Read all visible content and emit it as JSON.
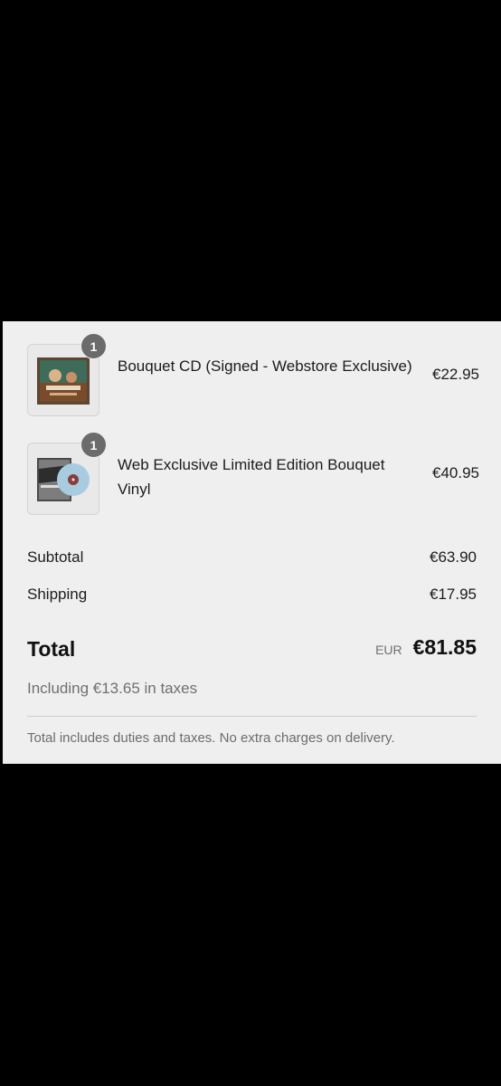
{
  "line_items": [
    {
      "name": "Bouquet CD (Signed - Webstore Exclusive)",
      "quantity": "1",
      "price": "€22.95",
      "thumbnail": "cd-cover-art"
    },
    {
      "name": "Web Exclusive Limited Edition Bouquet Vinyl",
      "quantity": "1",
      "price": "€40.95",
      "thumbnail": "vinyl-cover-art"
    }
  ],
  "summary": {
    "subtotal_label": "Subtotal",
    "subtotal_value": "€63.90",
    "shipping_label": "Shipping",
    "shipping_value": "€17.95",
    "total_label": "Total",
    "currency": "EUR",
    "total_value": "€81.85",
    "taxes_text": "Including €13.65 in taxes",
    "duties_note": "Total includes duties and taxes. No extra charges on delivery."
  },
  "colors": {
    "background": "#000000",
    "panel": "#efefef",
    "badge": "#6b6b6b",
    "text": "#1c1c1c",
    "muted_text": "#707070"
  }
}
